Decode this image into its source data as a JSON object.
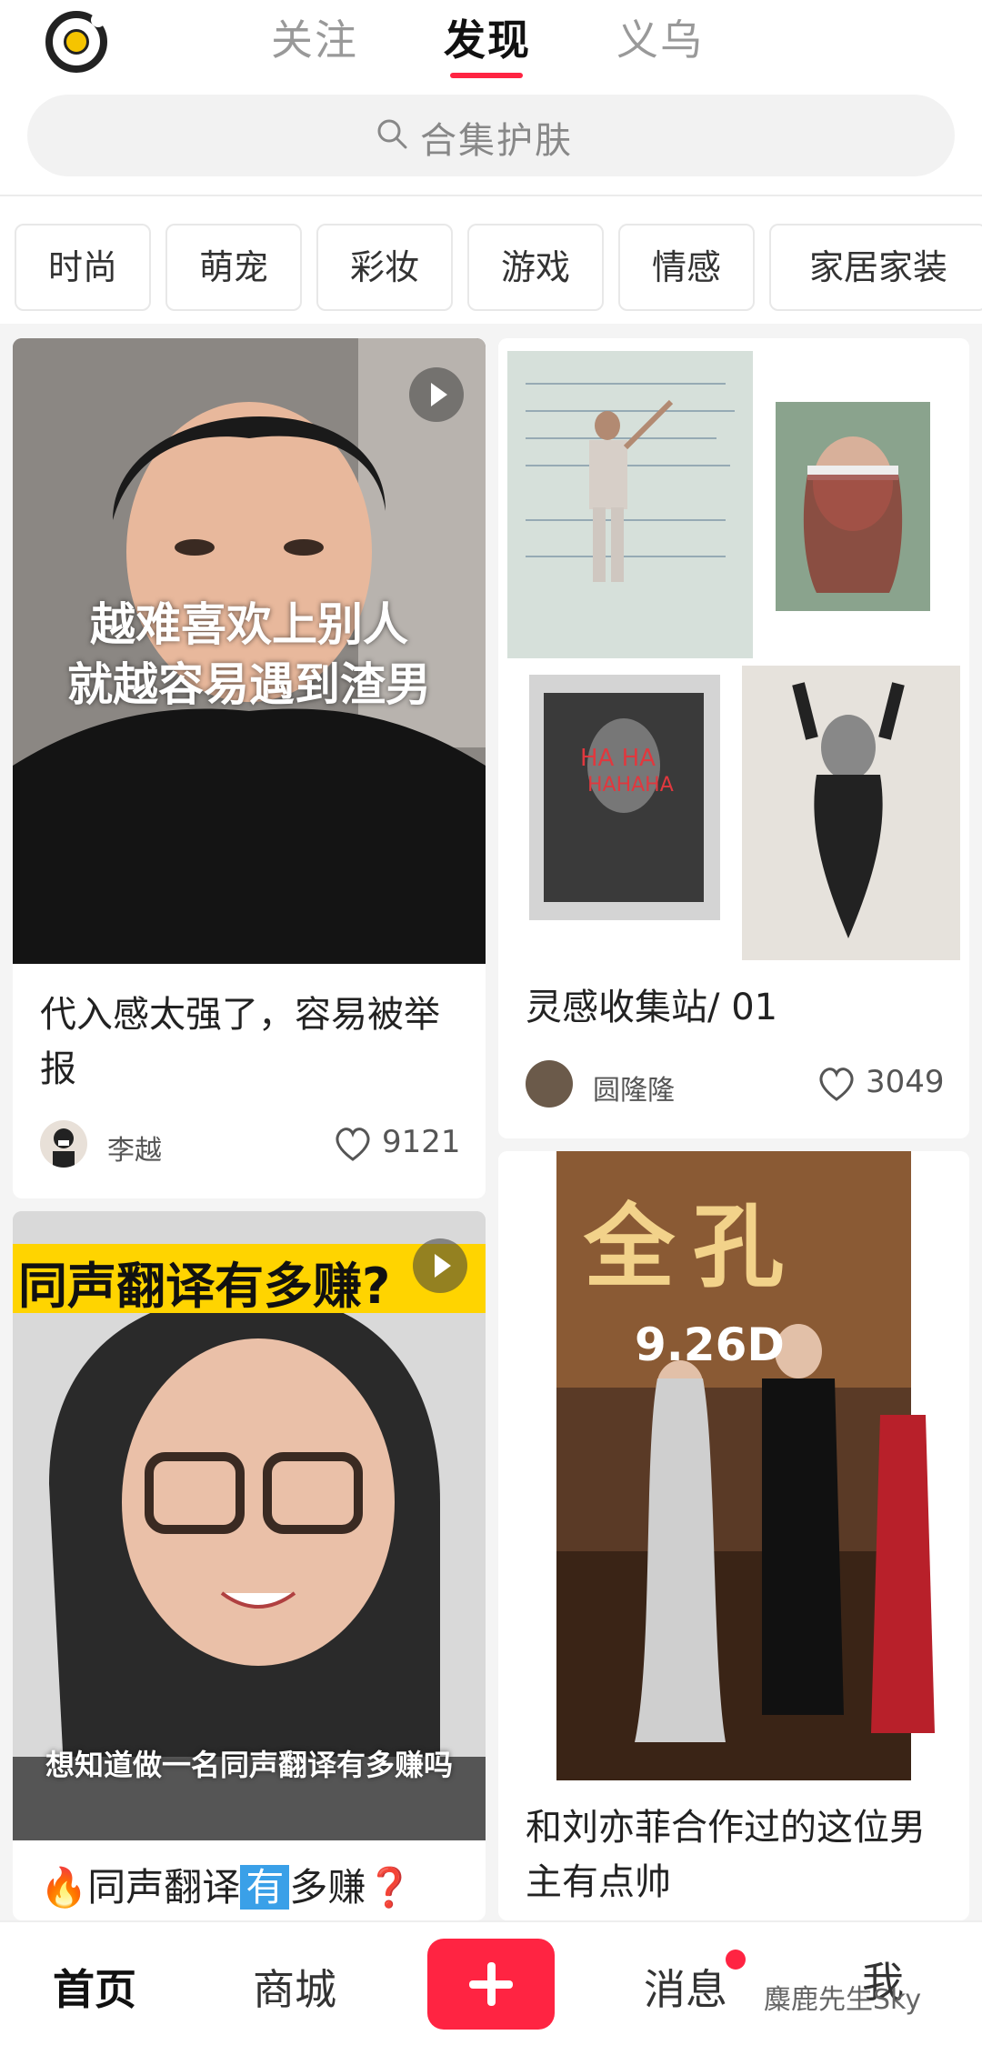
{
  "header": {
    "tabs": [
      "关注",
      "发现",
      "义乌"
    ],
    "active_tab": "发现",
    "search_placeholder": "合集护肤"
  },
  "categories": [
    "时尚",
    "萌宠",
    "彩妆",
    "游戏",
    "情感",
    "家居家装"
  ],
  "feed": [
    {
      "title": "代入感太强了，容易被举报",
      "overlay": "越难喜欢上别人\n就越容易遇到渣男",
      "author": "李越",
      "likes": "9121",
      "is_video": true
    },
    {
      "title": "灵感收集站/ 01",
      "author": "圆隆隆",
      "likes": "3049",
      "is_video": false
    },
    {
      "banner": "同声翻译有多赚?",
      "caption": "想知道做一名同声翻译有多赚吗",
      "title_pre": "同声翻译",
      "title_highlight": "有",
      "title_post": "多赚",
      "is_video": true
    },
    {
      "title": "和刘亦菲合作过的这位男主有点帅",
      "poster_text": "全孔",
      "poster_date": "9.26D",
      "is_video": false
    }
  ],
  "bottom_nav": {
    "home": "首页",
    "mall": "商城",
    "messages": "消息",
    "me": "我",
    "watermark": "麋鹿先生Sky"
  },
  "colors": {
    "accent": "#ff2442",
    "highlight_yellow": "#ffd400"
  }
}
